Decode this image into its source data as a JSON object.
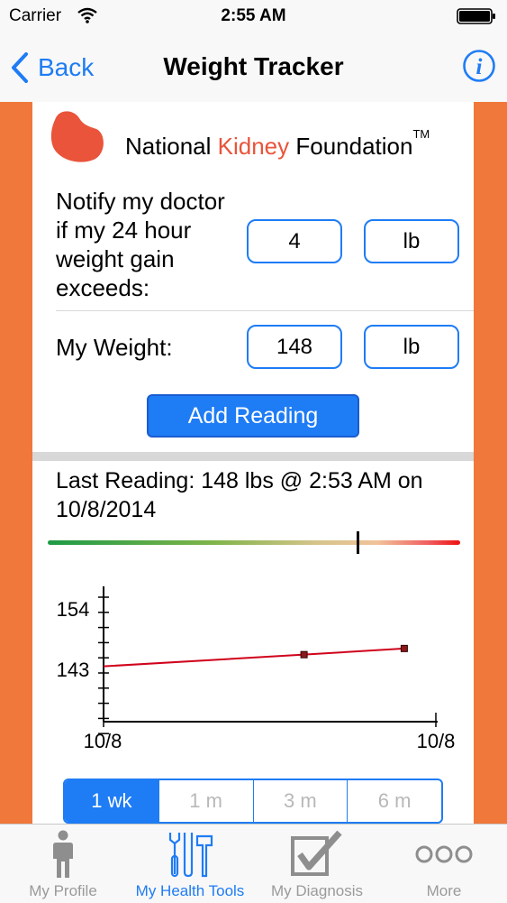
{
  "status": {
    "carrier": "Carrier",
    "time": "2:55 AM"
  },
  "nav": {
    "back_label": "Back",
    "title": "Weight Tracker"
  },
  "brand": {
    "prefix": "National ",
    "highlight": "Kidney",
    "suffix": " Foundation",
    "tm": "TM"
  },
  "notify": {
    "label": "Notify my doctor if my 24 hour weight gain exceeds:",
    "value": "4",
    "unit": "lb"
  },
  "weight": {
    "label": "My Weight:",
    "value": "148",
    "unit": "lb"
  },
  "add_reading_label": "Add Reading",
  "last_reading": "Last Reading: 148 lbs @ 2:53 AM on 10/8/2014",
  "gauge": {
    "level": 0.75
  },
  "colors": {
    "accent": "#1e7cf5",
    "orange": "#f0783a",
    "line": "#d0021b"
  },
  "chart_data": {
    "type": "line",
    "x_tick_labels": [
      "10/8",
      "10/8"
    ],
    "y_tick_labels": [
      "154",
      "143"
    ],
    "ylim": [
      136,
      158
    ],
    "series": [
      {
        "x": [
          0,
          0.6,
          0.9
        ],
        "values": [
          145,
          146.9,
          147.9
        ]
      }
    ]
  },
  "range_options": [
    {
      "label": "1 wk",
      "active": true
    },
    {
      "label": "1 m",
      "active": false
    },
    {
      "label": "3 m",
      "active": false
    },
    {
      "label": "6 m",
      "active": false
    }
  ],
  "tabs": [
    {
      "label": "My Profile",
      "icon": "person-icon",
      "active": false
    },
    {
      "label": "My Health Tools",
      "icon": "tools-icon",
      "active": true
    },
    {
      "label": "My Diagnosis",
      "icon": "checkbox-icon",
      "active": false
    },
    {
      "label": "More",
      "icon": "more-icon",
      "active": false
    }
  ]
}
